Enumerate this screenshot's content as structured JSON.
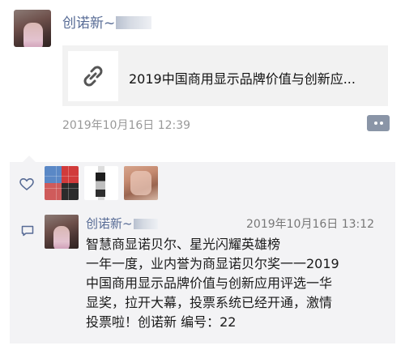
{
  "post": {
    "author": "创诺新~",
    "link_title": "2019中国商用显示品牌价值与创新应...",
    "time": "2019年10月16日 12:39"
  },
  "icons": {
    "link": "link-icon",
    "comment_button": "more-dots-icon",
    "like": "heart-icon",
    "comment": "comment-bubble-icon"
  },
  "likes": {
    "count_shown": 3
  },
  "comment": {
    "author": "创诺新~",
    "time": "2019年10月16日 13:12",
    "lines": [
      "智慧商显诺贝尔、星光闪耀英雄榜",
      "一年一度，业内誉为商显诺贝尔奖一一2019",
      "中国商用显示品牌价值与创新应用评选一华",
      "显奖，拉开大幕，投票系统已经开通，激情",
      "投票啦！创诺新 编号：22"
    ]
  },
  "colors": {
    "link_blue": "#576b95",
    "area_bg": "#f3f3f5",
    "card_bg": "#f2f2f2"
  }
}
